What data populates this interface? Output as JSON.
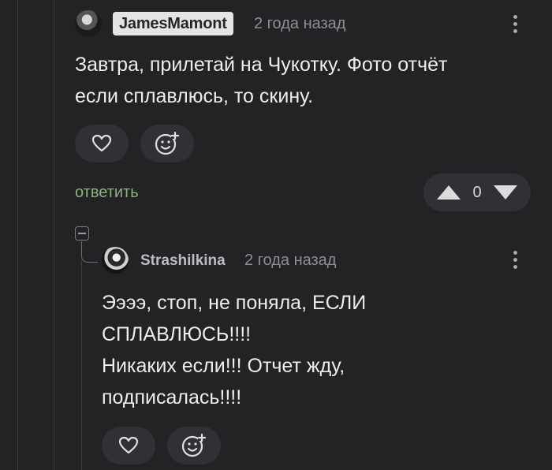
{
  "comments": [
    {
      "author": "JamesMamont",
      "time": "2 года назад",
      "lines": [
        "Завтра, прилетай на Чукотку. Фото отчёт",
        "если сплавлюсь, то скину."
      ],
      "reply_label": "ответить",
      "rating": "0",
      "icons": {
        "like": "heart-icon",
        "react": "emoji-plus-icon",
        "menu": "more-vertical-icon",
        "up": "arrow-up-icon",
        "down": "arrow-down-icon"
      }
    },
    {
      "author": "Strashilkina",
      "time": "2 года назад",
      "lines": [
        "Ээээ, стоп, не поняла, ЕСЛИ",
        "СПЛАВЛЮСЬ!!!!",
        "Никаких если!!! Отчет жду,",
        "подписалась!!!!"
      ],
      "icons": {
        "like": "heart-icon",
        "react": "emoji-plus-icon",
        "menu": "more-vertical-icon",
        "collapse": "collapse-icon"
      }
    }
  ],
  "colors": {
    "background": "#232326",
    "reply": "#8ab37c",
    "pill": "#313135"
  }
}
